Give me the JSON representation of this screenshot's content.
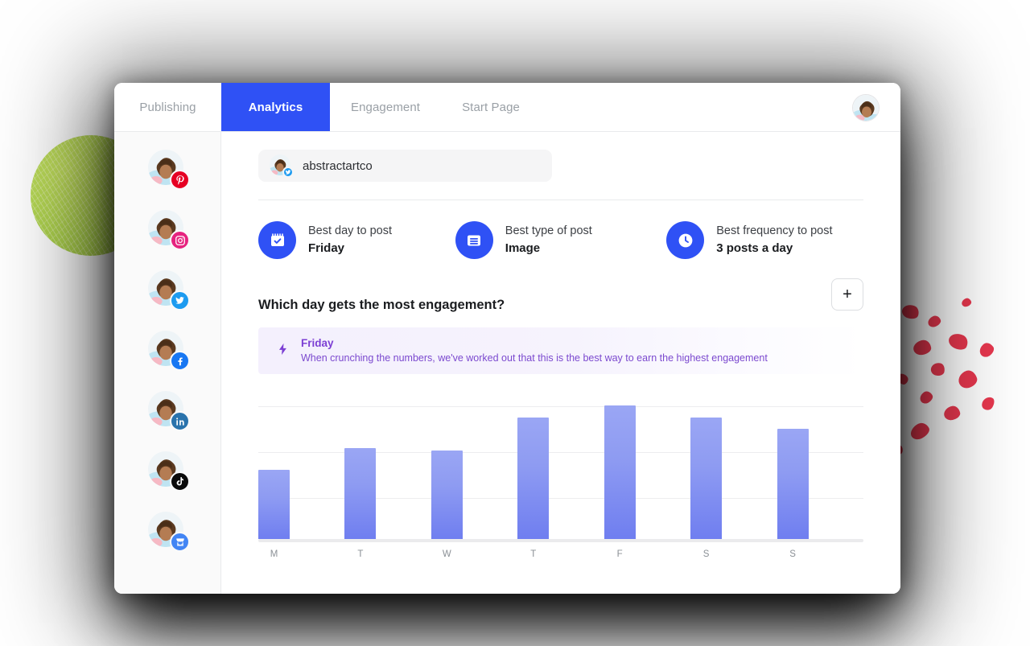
{
  "app": {
    "tabs": [
      {
        "label": "Publishing",
        "active": false
      },
      {
        "label": "Analytics",
        "active": true
      },
      {
        "label": "Engagement",
        "active": false
      },
      {
        "label": "Start Page",
        "active": false
      }
    ],
    "profile_avatar": "user-avatar"
  },
  "sidebar": {
    "accounts": [
      {
        "network": "pinterest",
        "icon": "pinterest-icon",
        "color": "#e60023"
      },
      {
        "network": "instagram",
        "icon": "instagram-icon",
        "color": "#e6237f"
      },
      {
        "network": "twitter",
        "icon": "twitter-icon",
        "color": "#1d9bf0"
      },
      {
        "network": "facebook",
        "icon": "facebook-icon",
        "color": "#1877f2"
      },
      {
        "network": "linkedin",
        "icon": "linkedin-icon",
        "color": "#2a73ac"
      },
      {
        "network": "tiktok",
        "icon": "tiktok-icon",
        "color": "#0b0b0b"
      },
      {
        "network": "google-business-profile",
        "icon": "storefront-icon",
        "color": "#4285f4"
      }
    ]
  },
  "account_selector": {
    "name": "abstractartco",
    "badge_icon": "twitter-icon",
    "badge_color": "#1d9bf0"
  },
  "insights": [
    {
      "icon": "calendar-check-icon",
      "label": "Best day to post",
      "value": "Friday"
    },
    {
      "icon": "document-lines-icon",
      "label": "Best type of post",
      "value": "Image"
    },
    {
      "icon": "clock-icon",
      "label": "Best frequency to post",
      "value": "3 posts a day"
    }
  ],
  "section": {
    "question": "Which day gets the most engagement?",
    "add_button_label": "+",
    "add_button_icon": "plus-icon"
  },
  "banner": {
    "icon": "lightning-bolt-icon",
    "title": "Friday",
    "subtitle": "When crunching the numbers, we've worked out that this is the best way to earn the highest engagement",
    "accent_color": "#7c3fd4"
  },
  "colors": {
    "accent_blue": "#2f51f5",
    "bar_top": "#9aa6f4",
    "bar_bottom": "#6f7ef0",
    "deco_green": "#b4d854",
    "deco_red": "#e8384f"
  },
  "chart_data": {
    "type": "bar",
    "title": "Which day gets the most engagement?",
    "categories": [
      "M",
      "T",
      "W",
      "T",
      "F",
      "S",
      "S"
    ],
    "values": [
      48,
      63,
      61,
      84,
      92,
      84,
      76
    ],
    "xlabel": "",
    "ylabel": "",
    "ylim": [
      0,
      100
    ],
    "grid": true,
    "gridlines": [
      33,
      66,
      100
    ],
    "legend": "none",
    "highlight_category": "F"
  }
}
